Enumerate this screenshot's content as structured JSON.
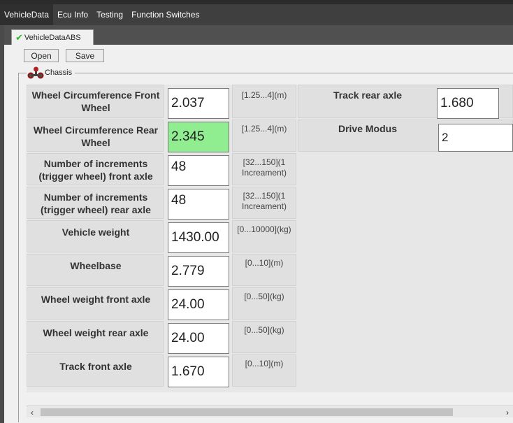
{
  "menu": [
    {
      "label": "VehicleData",
      "active": true
    },
    {
      "label": "Ecu Info"
    },
    {
      "label": "Testing"
    },
    {
      "label": "Function Switches"
    }
  ],
  "subtab": {
    "label": "VehicleDataABS"
  },
  "toolbar": {
    "open_label": "Open",
    "save_label": "Save"
  },
  "section": {
    "title": "Chassis"
  },
  "fields_left": [
    {
      "label": "Wheel Circumference Front Wheel",
      "value": "2.037",
      "range": "[1.25...4](m)"
    },
    {
      "label": "Wheel Circumference Rear Wheel",
      "value": "2.345",
      "range": "[1.25...4](m)",
      "highlight": true
    },
    {
      "label": "Number of increments (trigger wheel) front axle",
      "value": "48",
      "range": "[32...150](1 Increament)"
    },
    {
      "label": "Number of increments (trigger wheel) rear axle",
      "value": "48",
      "range": "[32...150](1 Increament)"
    },
    {
      "label": "Vehicle weight",
      "value": "1430.00",
      "range": "[0...10000](kg)"
    },
    {
      "label": "Wheelbase",
      "value": "2.779",
      "range": "[0...10](m)"
    },
    {
      "label": "Wheel weight front axle",
      "value": "24.00",
      "range": "[0...50](kg)"
    },
    {
      "label": "Wheel weight rear axle",
      "value": "24.00",
      "range": "[0...50](kg)"
    },
    {
      "label": "Track front axle",
      "value": "1.670",
      "range": "[0...10](m)"
    }
  ],
  "fields_right": [
    {
      "label": "Track rear axle",
      "value": "1.680"
    },
    {
      "label": "Drive Modus",
      "value": "2"
    }
  ],
  "scrollbar": {
    "left_arrow": "‹",
    "right_arrow": "›"
  },
  "colors": {
    "highlight": "#90ee90",
    "menubar": "#3f3f3f",
    "panel": "#f0f0f0"
  }
}
